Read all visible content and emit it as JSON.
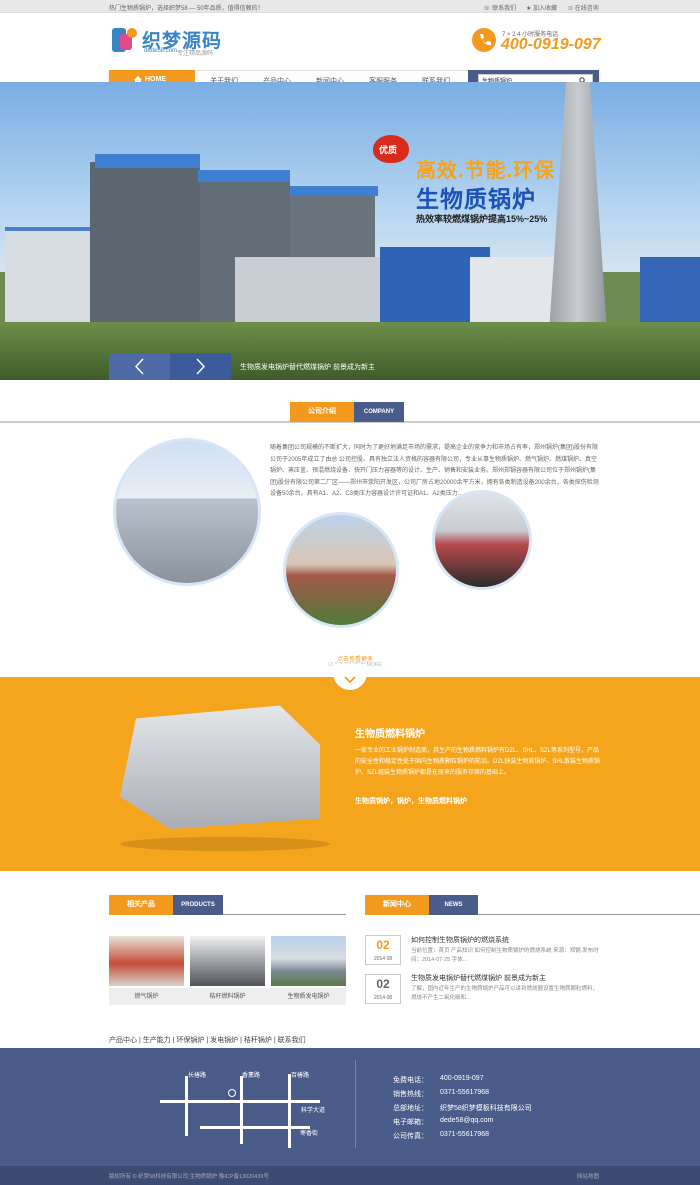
{
  "topbar": {
    "greeting": "热门生物质锅炉，选择织梦58 — 50年品质，值得信赖的！",
    "contact_us": "联系我们",
    "favorite": "加入收藏",
    "online": "在线咨询"
  },
  "header": {
    "logo_title": "织梦源码",
    "logo_domain": "dede58.com",
    "logo_slogan": "专注精品源码",
    "hotline_label": "7 × 2 4 小时服务电话",
    "hotline_number": "400-0919-097"
  },
  "nav": {
    "home": "HOME",
    "items": [
      "关于我们",
      "产品中心",
      "新闻中心",
      "客服服务",
      "联系我们"
    ],
    "search_value": "生物质锅炉"
  },
  "banner": {
    "badge": "优质",
    "line1": "高效.节能.环保",
    "line2": "生物质锅炉",
    "line3": "热效率较燃煤锅炉提高15%~25%",
    "caption": "生物质发电锅炉替代燃煤锅炉 前景成为新主"
  },
  "about": {
    "tab_cn": "公司介绍",
    "tab_en": "COMPANY",
    "text": "随着集团公司规模的不断扩大，同时为了更好地满足市场的需求，提高企业的竞争力和市场占有率，郑州锅炉(集团)股份有限公司于2005年成立了由总 公司控股、具有独立法人资格的容器有限公司，专业从事生物质锅炉、燃气锅炉、燃煤锅炉、真空锅炉、蒸压釜、预混燃烧设备、快开门压力容器等的设计、生产、销售和安装业务。郑州郑锅容器有限公司位于郑州锅炉(集团)股份有限公司第二厂区——郑州市荥阳开发区，公司厂房占地20000余平方米，拥有各类制造设备200余台，各类探伤检测设备50余台，具有A1、A2、C3类压力容器设计许可证和A1、A2类压力...",
    "more_cn": "点击查看更多",
    "more_en": "CLICK TO VIEW MORE"
  },
  "product": {
    "title": "生物质燃料锅炉",
    "desc": "一家专业的工业锅炉制造商，其生产的生物质燃料锅炉有DZL、SHL、SZL等系列型号，产品的安全性和稳定性处于国内生物质颗粒锅炉的前沿。DZL快装生物质锅炉、SHL散装生物质锅炉、SZL组装生物质锅炉都是在原来的服务存续的基础上。",
    "sub": "生物质锅炉，锅炉，生物质燃料锅炉"
  },
  "related": {
    "tab_cn": "相关产品",
    "tab_en": "PRODUCTS",
    "items": [
      "燃气锅炉",
      "秸秆燃料锅炉",
      "生物质发电锅炉"
    ]
  },
  "news": {
    "tab_cn": "新闻中心",
    "tab_en": "NEWS",
    "items": [
      {
        "day": "02",
        "ym": "2014 08",
        "title": "如何控制生物质锅炉的燃烧系统",
        "desc": "当前位置：首页 产品知识 如何控制生物质锅炉的燃烧系统 来源：郑锅 发布时间：2014-07-25 字体..."
      },
      {
        "day": "02",
        "ym": "2014 08",
        "title": "生物质发电锅炉替代燃煤锅炉 前景成为新主",
        "desc": "了解，国内近年生产的生物质锅炉产品可以讲到燃烧器设置生物质颗粒燃料，燃烧不产生二氧化碳和..."
      }
    ]
  },
  "quick_links": [
    "产品中心",
    "生产能力",
    "环保锅炉",
    "发电锅炉",
    "秸秆锅炉",
    "联系我们"
  ],
  "footer": {
    "map_labels": [
      "长椿路",
      "香薰路",
      "百椿路",
      "科学大道",
      "枣香街"
    ],
    "contacts": [
      {
        "label": "免费电话：",
        "value": "400-0919-097"
      },
      {
        "label": "销售热线：",
        "value": "0371-55617968"
      },
      {
        "label": "总部地址：",
        "value": "织梦58织梦模板科技有限公司"
      },
      {
        "label": "电子邮箱：",
        "value": "dede58@qq.com"
      },
      {
        "label": "公司传真：",
        "value": "0371-55617968"
      }
    ],
    "copyright": "版权所有 © 织梦58科技有限公司 生物质锅炉 豫ICP备13020439号",
    "sitemap": "网站地图"
  },
  "colors": {
    "accent": "#f39a1e",
    "navy": "#4a5c8a",
    "blue_text": "#1b52b5"
  }
}
